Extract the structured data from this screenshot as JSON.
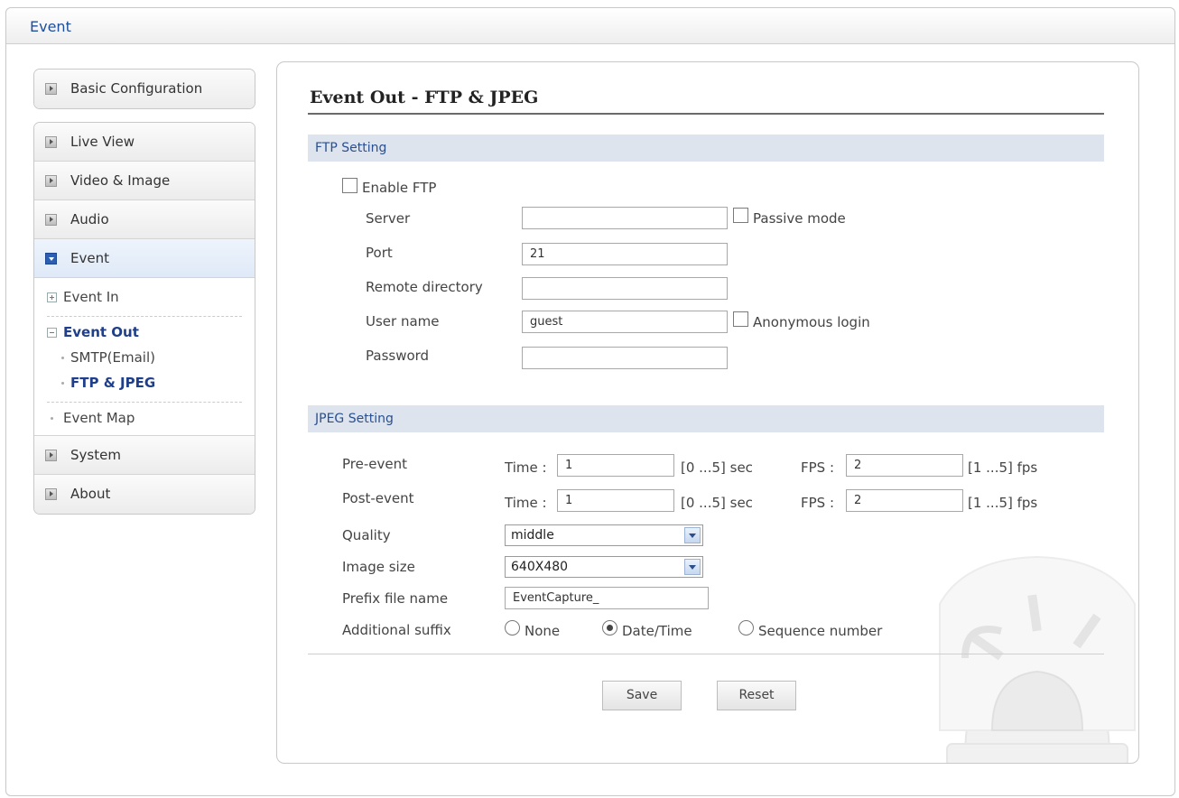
{
  "header": {
    "title": "Event"
  },
  "sidebar": {
    "top_item": "Basic Configuration",
    "items": [
      "Live View",
      "Video & Image",
      "Audio",
      "Event"
    ],
    "event_sub": {
      "event_in": "Event In",
      "event_out": "Event Out",
      "smtp": "SMTP(Email)",
      "ftp_jpeg": "FTP & JPEG",
      "event_map": "Event Map"
    },
    "bottom_items": [
      "System",
      "About"
    ]
  },
  "page": {
    "title": "Event Out - FTP & JPEG"
  },
  "ftp": {
    "section": "FTP Setting",
    "enable_label": "Enable FTP",
    "server_label": "Server",
    "server_value": "",
    "passive_label": "Passive mode",
    "port_label": "Port",
    "port_value": "21",
    "remote_label": "Remote directory",
    "remote_value": "",
    "user_label": "User name",
    "user_value": "guest",
    "anon_label": "Anonymous login",
    "password_label": "Password",
    "password_value": ""
  },
  "jpeg": {
    "section": "JPEG Setting",
    "pre_label": "Pre-event",
    "post_label": "Post-event",
    "time_label": "Time :",
    "fps_label": "FPS :",
    "pre_time": "1",
    "pre_fps": "2",
    "post_time": "1",
    "post_fps": "2",
    "time_range": "[0 ...5] sec",
    "fps_range": "[1 ...5] fps",
    "quality_label": "Quality",
    "quality_value": "middle",
    "size_label": "Image size",
    "size_value": "640X480",
    "prefix_label": "Prefix file name",
    "prefix_value": "EventCapture_",
    "suffix_label": "Additional suffix",
    "suffix_options": [
      "None",
      "Date/Time",
      "Sequence number"
    ],
    "suffix_selected": "Date/Time"
  },
  "buttons": {
    "save": "Save",
    "reset": "Reset"
  }
}
